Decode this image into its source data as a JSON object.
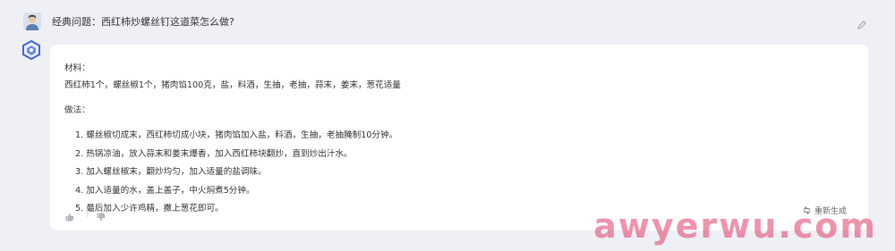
{
  "question": {
    "text": "经典问题：西红柿炒螺丝钉这道菜怎么做?"
  },
  "answer": {
    "materials_title": "材料：",
    "materials": "西红柿1个，螺丝椒1个，猪肉馅100克，盐，料酒，生抽，老抽，蒜末，姜末，葱花适量",
    "method_title": "做法：",
    "steps": [
      "1. 螺丝椒切成末，西红柿切成小块，猪肉馅加入盐，料酒，生抽，老抽腌制10分钟。",
      "2. 热锅凉油，放入蒜末和姜末爆香，加入西红柿块翻炒，直到炒出汁水。",
      "3. 加入螺丝椒末，翻炒均匀，加入适量的盐调味。",
      "4. 加入适量的水，盖上盖子，中火焖煮5分钟。",
      "5. 最后加入少许鸡精，撒上葱花即可。"
    ]
  },
  "actions": {
    "regenerate_label": "重新生成"
  },
  "watermark": "awyerwu.com",
  "icons": {
    "user_avatar": "user-avatar-icon",
    "bot_avatar": "bot-logo-icon",
    "edit": "pencil-icon",
    "like": "thumbs-up-icon",
    "dislike": "thumbs-down-icon",
    "regenerate": "refresh-icon"
  }
}
